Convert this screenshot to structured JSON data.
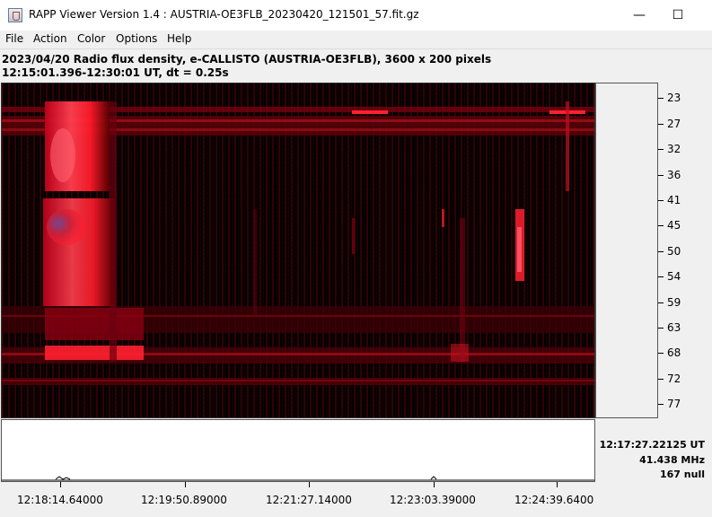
{
  "window": {
    "title": "RAPP Viewer Version 1.4 : AUSTRIA-OE3FLB_20230420_121501_57.fit.gz",
    "minimize_glyph": "—",
    "maximize_glyph": "☐"
  },
  "menu": {
    "items": [
      "File",
      "Action",
      "Color",
      "Options",
      "Help"
    ]
  },
  "info": {
    "line1": "2023/04/20  Radio flux density, e-CALLISTO (AUSTRIA-OE3FLB),  3600 x 200 pixels",
    "line2": "12:15:01.396-12:30:01 UT,  dt = 0.25s"
  },
  "spectrogram": {
    "colormap": [
      "#000000",
      "#5a0000",
      "#c0001a",
      "#ff1a2a",
      "#ff5060",
      "#6a4a9a"
    ],
    "y_ticks": [
      "23",
      "27",
      "32",
      "36",
      "41",
      "45",
      "50",
      "54",
      "59",
      "63",
      "68",
      "72",
      "77"
    ],
    "x_ticks": [
      "12:18:14.64000",
      "12:19:50.89000",
      "12:21:27.14000",
      "12:23:03.39000",
      "12:24:39.6400"
    ]
  },
  "readout": {
    "time": "12:17:27.22125 UT",
    "frequency": "41.438 MHz",
    "value": "167 null"
  }
}
